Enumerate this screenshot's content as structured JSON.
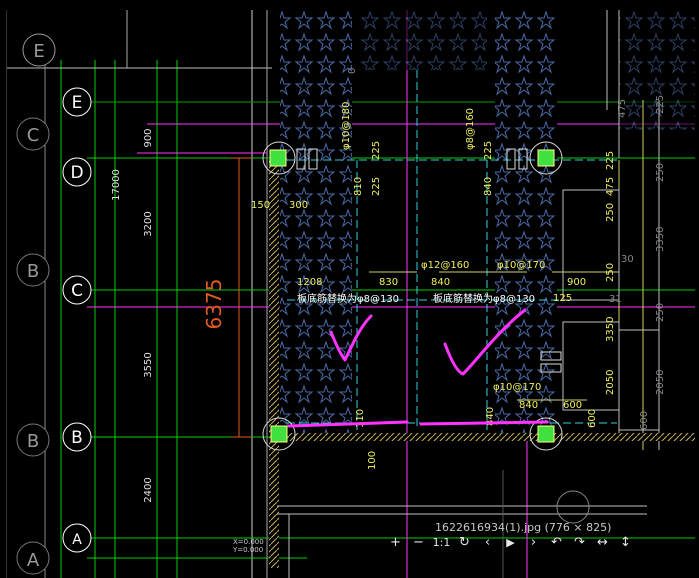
{
  "viewer": {
    "filename": "1622616934(1).jpg (776 × 825)",
    "toolbar": {
      "zoom_in": "+",
      "zoom_out": "−",
      "actual_size": "1:1",
      "refresh": "↻",
      "prev": "‹",
      "play": "▶",
      "next": "›",
      "rotate_left": "↶",
      "rotate_right": "↷",
      "fit_width": "↔",
      "fit_height": "↕"
    }
  },
  "drawing": {
    "axis_left": [
      "E",
      "C",
      "B",
      "C",
      "B",
      "A"
    ],
    "axis_main": [
      "E",
      "D",
      "C",
      "B",
      "A"
    ],
    "dims_left": [
      "17000",
      "900",
      "3200",
      "3550",
      "2400"
    ],
    "dim_big": "6375",
    "dims_col1": [
      "φ10@180",
      "225",
      "810",
      "225",
      "1208",
      "830",
      "840",
      "150",
      "300",
      "100",
      "110"
    ],
    "dims_col2": [
      "φ8@160",
      "225",
      "840",
      "φ12@160",
      "φ10@170",
      "900",
      "125",
      "φ10@170",
      "840",
      "600",
      "840",
      "600"
    ],
    "dims_right": [
      "225",
      "475",
      "250",
      "250",
      "3350",
      "250",
      "250",
      "2050",
      "600",
      "475",
      "225",
      "250",
      "3350",
      "30",
      "31",
      "250",
      "2050",
      "600"
    ],
    "notes": [
      "板底筋替换为φ8@130",
      "板底筋替换为φ8@130"
    ],
    "coords": [
      "X=0.000",
      "Y=0.000"
    ],
    "small": [
      "0",
      "0"
    ],
    "colors": {
      "background": "#000000",
      "grid": "#00e000",
      "bubble": "#ffffff",
      "wall_hatch": "#4a6aa8",
      "dim_red": "#e05a20",
      "dim_yellow": "#f0f060",
      "cyan": "#30d0e0",
      "magenta": "#ff33ff",
      "column": "#40e040"
    }
  }
}
